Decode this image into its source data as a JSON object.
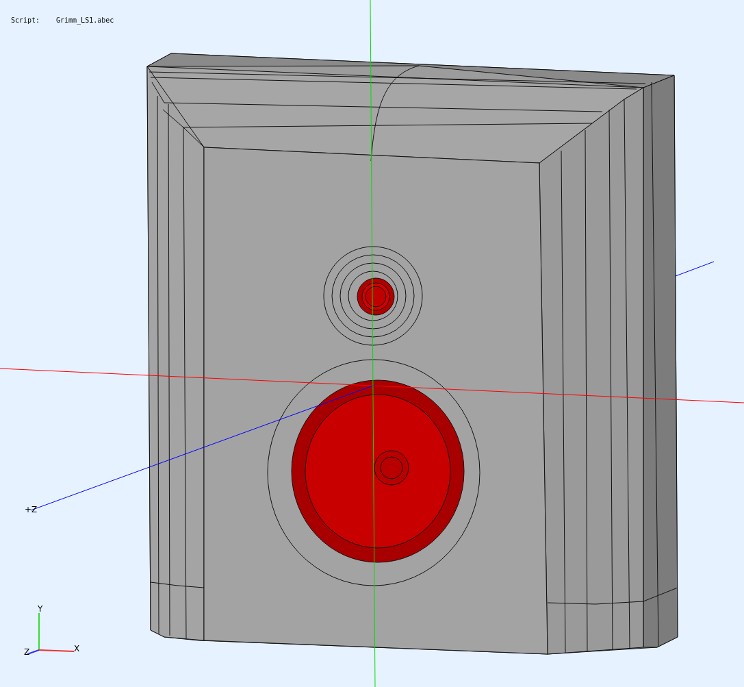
{
  "script": {
    "label": "Script:",
    "file": "Grimm_LS1.abec"
  },
  "scene_axes": {
    "z_label": "+Z"
  },
  "orientation_triad": {
    "y": "Y",
    "z": "Z",
    "x": "X"
  }
}
